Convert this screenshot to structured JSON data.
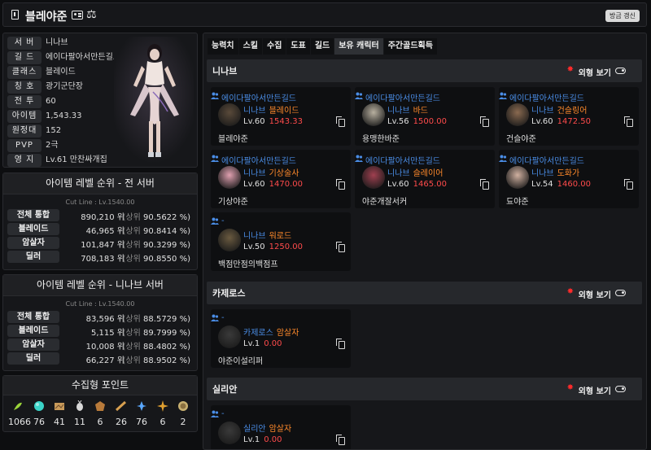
{
  "header": {
    "title": "블레야준",
    "refresh_label": "방금 갱신"
  },
  "profile": {
    "rows": [
      {
        "label": "서 버",
        "value": "니나브"
      },
      {
        "label": "길 드",
        "value": "에이다팔아서만든길드"
      },
      {
        "label": "클래스",
        "value": "블레이드"
      },
      {
        "label": "칭 호",
        "value": "광기군단장"
      },
      {
        "label": "전 투",
        "value": "60"
      },
      {
        "label": "아이템",
        "value": "1,543.33"
      },
      {
        "label": "원정대",
        "value": "152"
      },
      {
        "label": "PVP",
        "value": "2극"
      },
      {
        "label": "영 지",
        "value": "Lv.61 만찬싸개집"
      }
    ]
  },
  "rank_all": {
    "title": "아이템 레벨 순위 - 전 서버",
    "cutline": "Cut Line : Lv.1540.00",
    "rows": [
      {
        "label": "전체 통합",
        "rank": "890,210 위",
        "pct": "90.5622 %"
      },
      {
        "label": "블레이드",
        "rank": "46,965 위",
        "pct": "90.8414 %"
      },
      {
        "label": "암살자",
        "rank": "101,847 위",
        "pct": "90.3299 %"
      },
      {
        "label": "딜러",
        "rank": "708,183 위",
        "pct": "90.8550 %"
      }
    ]
  },
  "rank_server": {
    "title": "아이템 레벨 순위 - 니나브 서버",
    "cutline": "Cut Line : Lv.1540.00",
    "rows": [
      {
        "label": "전체 통합",
        "rank": "83,596 위",
        "pct": "88.5729 %"
      },
      {
        "label": "블레이드",
        "rank": "5,115 위",
        "pct": "89.7999 %"
      },
      {
        "label": "암살자",
        "rank": "10,008 위",
        "pct": "88.4802 %"
      },
      {
        "label": "딜러",
        "rank": "66,227 위",
        "pct": "88.9502 %"
      }
    ]
  },
  "rank_common": {
    "prefix": "(상위"
  },
  "collect": {
    "title": "수집형 포인트",
    "items": [
      {
        "icon": "seed-icon",
        "count": "1066",
        "color": "#9bd43a"
      },
      {
        "icon": "island-heart-icon",
        "count": "76",
        "color": "#3ad4c8"
      },
      {
        "icon": "art-icon",
        "count": "41",
        "color": "#c89a5a"
      },
      {
        "icon": "mokoko-icon",
        "count": "11",
        "color": "#d8d8d8"
      },
      {
        "icon": "emblem-icon",
        "count": "6",
        "color": "#b87a3a"
      },
      {
        "icon": "voyage-icon",
        "count": "26",
        "color": "#d8a050"
      },
      {
        "icon": "leaf-icon",
        "count": "76",
        "color": "#5aa8ff"
      },
      {
        "icon": "orb-icon",
        "count": "6",
        "color": "#e0a030"
      },
      {
        "icon": "medal-icon",
        "count": "2",
        "color": "#c8b070"
      }
    ]
  },
  "tabs": [
    {
      "label": "능력치",
      "active": false
    },
    {
      "label": "스킬",
      "active": false
    },
    {
      "label": "수집",
      "active": false
    },
    {
      "label": "도표",
      "active": false
    },
    {
      "label": "길드",
      "active": false
    },
    {
      "label": "보유 캐릭터",
      "active": true
    },
    {
      "label": "주간골드획득",
      "active": false
    }
  ],
  "look_label": "외형 보기",
  "servers": [
    {
      "name": "니나브",
      "characters": [
        {
          "guild": "에이다팔아서만든길드",
          "server": "니나브",
          "cls": "블레이드",
          "lv": "Lv.60",
          "ilvl": "1543.33",
          "nick": "블레야준",
          "avatar": "#5a4a3a"
        },
        {
          "guild": "에이다팔아서만든길드",
          "server": "니나브",
          "cls": "바드",
          "lv": "Lv.56",
          "ilvl": "1500.00",
          "nick": "용맹한바준",
          "avatar": "#b8b0a0"
        },
        {
          "guild": "에이다팔아서만든길드",
          "server": "니나브",
          "cls": "건슬링어",
          "lv": "Lv.60",
          "ilvl": "1472.50",
          "nick": "건슬야준",
          "avatar": "#8a6a50"
        },
        {
          "guild": "에이다팔아서만든길드",
          "server": "니나브",
          "cls": "기상술사",
          "lv": "Lv.60",
          "ilvl": "1470.00",
          "nick": "기상야준",
          "avatar": "#e0a0b0"
        },
        {
          "guild": "에이다팔아서만든길드",
          "server": "니나브",
          "cls": "슬레이어",
          "lv": "Lv.60",
          "ilvl": "1465.00",
          "nick": "야준개잘서커",
          "avatar": "#a04050"
        },
        {
          "guild": "에이다팔아서만든길드",
          "server": "니나브",
          "cls": "도화가",
          "lv": "Lv.54",
          "ilvl": "1460.00",
          "nick": "됴야준",
          "avatar": "#d0b0a0"
        },
        {
          "guild": "-",
          "server": "니나브",
          "cls": "워로드",
          "lv": "Lv.50",
          "ilvl": "1250.00",
          "nick": "백점만점의백점프",
          "avatar": "#6a5a40"
        }
      ]
    },
    {
      "name": "카제로스",
      "characters": [
        {
          "guild": "-",
          "server": "카제로스",
          "cls": "암살자",
          "lv": "Lv.1",
          "ilvl": "0.00",
          "nick": "야준이설리퍼",
          "avatar": "#3a3a3a"
        }
      ]
    },
    {
      "name": "실리안",
      "characters": [
        {
          "guild": "-",
          "server": "실리안",
          "cls": "암살자",
          "lv": "Lv.1",
          "ilvl": "0.00",
          "nick": "",
          "avatar": "#3a3a3a"
        }
      ]
    }
  ]
}
